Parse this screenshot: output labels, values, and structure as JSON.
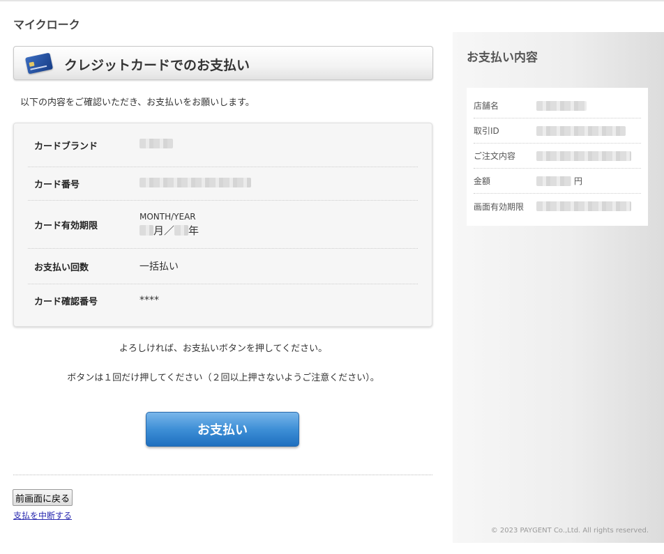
{
  "header": {
    "shop_name": "マイクローク"
  },
  "main": {
    "title": "クレジットカードでのお支払い",
    "title_icon": "credit-card-icon",
    "intro": "以下の内容をご確認いただき、お支払いをお願いします。",
    "fields": {
      "brand_label": "カードブランド",
      "number_label": "カード番号",
      "expiry_label": "カード有効期限",
      "expiry_caption": "MONTH/YEAR",
      "expiry_month_suffix": "月／",
      "expiry_year_suffix": "年",
      "installments_label": "お支払い回数",
      "installments_value": "一括払い",
      "cvv_label": "カード確認番号",
      "cvv_value": "****"
    },
    "confirm_message": "よろしければ、お支払いボタンを押してください。",
    "once_message": "ボタンは１回だけ押してください（２回以上押さないようご注意ください）。",
    "pay_button": "お支払い",
    "back_button": "前画面に戻る",
    "cancel_link": "支払を中断する"
  },
  "sidebar": {
    "title": "お支払い内容",
    "rows": {
      "store_label": "店舗名",
      "transaction_label": "取引ID",
      "order_label": "ご注文内容",
      "amount_label": "金額",
      "amount_unit": "円",
      "expiry_label": "画面有効期限"
    },
    "copyright": "© 2023 PAYGENT Co.,Ltd. All rights reserved."
  },
  "colors": {
    "pay_button": "#3e8fd6",
    "link": "#2b2bb0",
    "sidebar_bg": "#eeeeee"
  }
}
